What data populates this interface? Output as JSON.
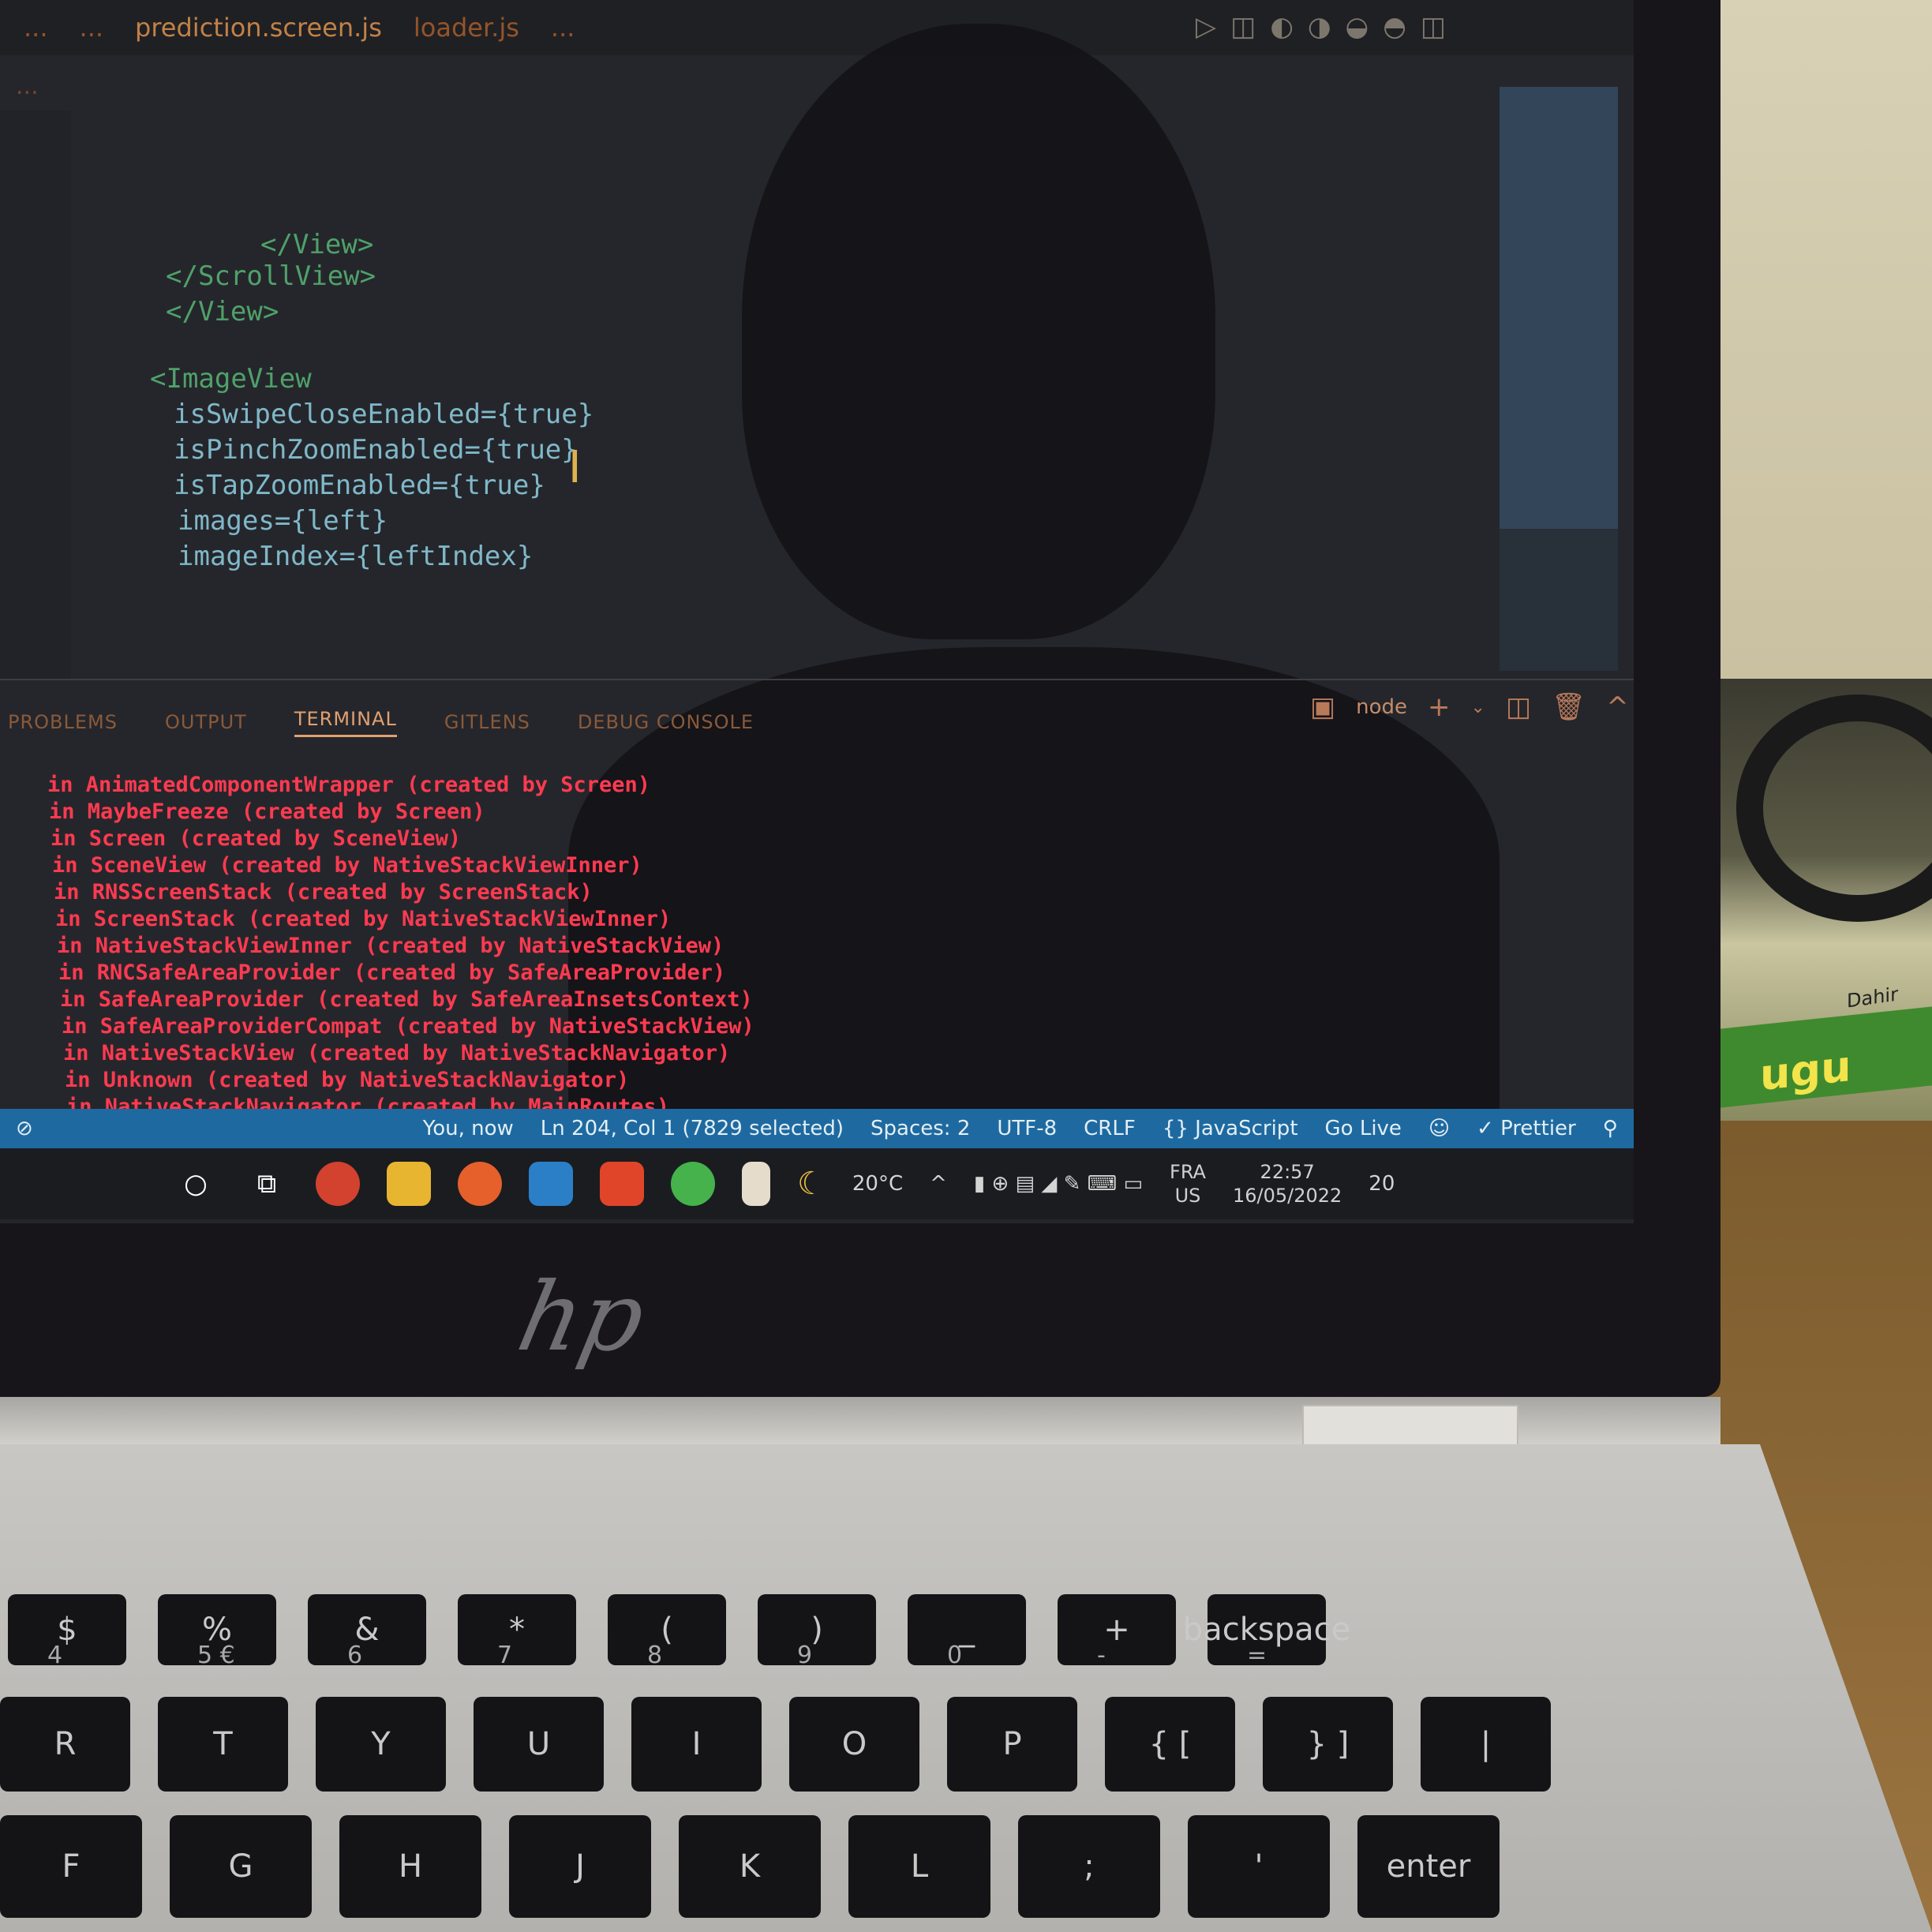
{
  "editor": {
    "tabs": [
      "...",
      "...",
      "prediction.screen.js",
      "loader.js",
      "..."
    ],
    "breadcrumb": "...",
    "code_lines": [
      {
        "text": "</View>",
        "kind": "tag"
      },
      {
        "text": "</ScrollView>",
        "kind": "tag"
      },
      {
        "text": "</View>",
        "kind": "tag"
      },
      {
        "text": "<ImageView",
        "kind": "tag"
      },
      {
        "text": "isSwipeCloseEnabled={true}",
        "kind": "prop"
      },
      {
        "text": "isPinchZoomEnabled={true}",
        "kind": "prop"
      },
      {
        "text": "isTapZoomEnabled={true}",
        "kind": "prop"
      },
      {
        "text": "images={left}",
        "kind": "prop"
      },
      {
        "text": "imageIndex={leftIndex}",
        "kind": "prop"
      }
    ]
  },
  "panel": {
    "tabs": [
      "PROBLEMS",
      "OUTPUT",
      "TERMINAL",
      "GITLENS",
      "DEBUG CONSOLE"
    ],
    "active_tab": "TERMINAL",
    "shell_label": "node"
  },
  "terminal": {
    "lines": [
      "in AnimatedComponentWrapper (created by Screen)",
      "in MaybeFreeze (created by Screen)",
      "in Screen (created by SceneView)",
      "in SceneView (created by NativeStackViewInner)",
      "in RNSScreenStack (created by ScreenStack)",
      "in ScreenStack (created by NativeStackViewInner)",
      "in NativeStackViewInner (created by NativeStackView)",
      "in RNCSafeAreaProvider (created by SafeAreaProvider)",
      "in SafeAreaProvider (created by SafeAreaInsetsContext)",
      "in SafeAreaProviderCompat (created by NativeStackView)",
      "in NativeStackView (created by NativeStackNavigator)",
      "in Unknown (created by NativeStackNavigator)",
      "in NativeStackNavigator (created by MainRoutes)"
    ]
  },
  "statusbar": {
    "blame": "You, now",
    "position": "Ln 204, Col 1 (7829 selected)",
    "spaces": "Spaces: 2",
    "encoding": "UTF-8",
    "eol": "CRLF",
    "language": "{} JavaScript",
    "golive": "Go Live",
    "prettier": "✓ Prettier"
  },
  "taskbar": {
    "weather": "20°C",
    "lang_top": "FRA",
    "lang_bottom": "US",
    "time": "22:57",
    "date": "16/05/2022",
    "notifications": "20"
  },
  "bag": {
    "text": "ugu",
    "brand": "Dahir"
  },
  "keyboard": {
    "row1": [
      "$",
      "%",
      "&",
      "*",
      "(",
      ")",
      "_",
      "+",
      "backspace"
    ],
    "row1_lower": [
      "4",
      "5 €",
      "6",
      "7",
      "8",
      "9",
      "0",
      "-",
      "="
    ],
    "row2": [
      "R",
      "T",
      "Y",
      "U",
      "I",
      "O",
      "P",
      "{ [",
      "} ]",
      "|"
    ],
    "row3": [
      "F",
      "G",
      "H",
      "J",
      "K",
      "L",
      ";",
      "'",
      "enter"
    ]
  },
  "colors": {
    "terminal_error": "#ff3a50",
    "statusbar": "#1e6aa0",
    "tag": "#4fa16a",
    "prop": "#7fb8c9"
  }
}
